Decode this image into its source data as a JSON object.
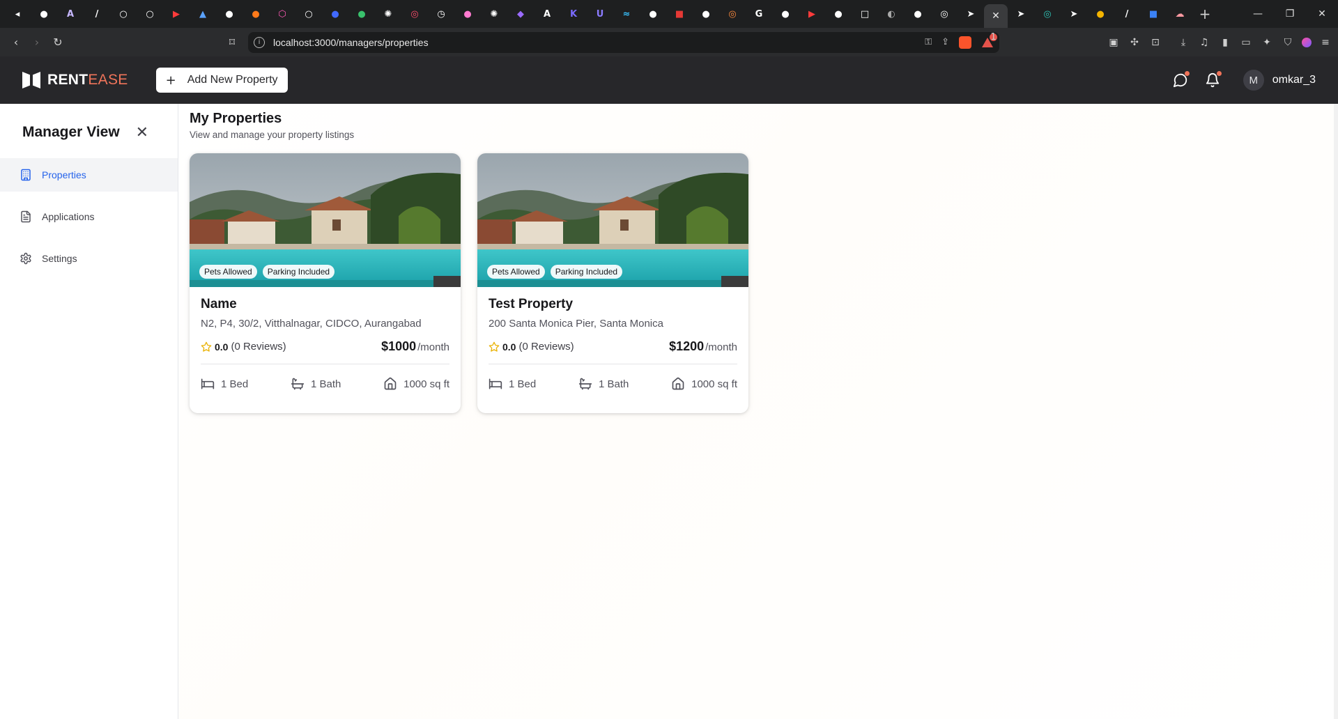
{
  "browser": {
    "tab_favicons": [
      {
        "name": "speaker-icon",
        "glyph": "◂",
        "color": "#ffffff"
      },
      {
        "name": "github-icon",
        "glyph": "●",
        "color": "#ffffff"
      },
      {
        "name": "arc-icon",
        "glyph": "A",
        "color": "#c7b8ff"
      },
      {
        "name": "pen-icon",
        "glyph": "/",
        "color": "#ffffff"
      },
      {
        "name": "circle-icon",
        "glyph": "○",
        "color": "#ffffff"
      },
      {
        "name": "circle-icon",
        "glyph": "○",
        "color": "#ffffff"
      },
      {
        "name": "youtube-icon",
        "glyph": "▶",
        "color": "#ff3b3b"
      },
      {
        "name": "triangle-icon",
        "glyph": "▲",
        "color": "#5aa2ff"
      },
      {
        "name": "github-icon",
        "glyph": "●",
        "color": "#ffffff"
      },
      {
        "name": "orange-icon",
        "glyph": "●",
        "color": "#ff7a1a"
      },
      {
        "name": "hexagon-icon",
        "glyph": "⬡",
        "color": "#ff5ab5"
      },
      {
        "name": "circle-icon",
        "glyph": "○",
        "color": "#ffffff"
      },
      {
        "name": "blue-circle-icon",
        "glyph": "●",
        "color": "#4169ff"
      },
      {
        "name": "green-circle-icon",
        "glyph": "●",
        "color": "#39c16c"
      },
      {
        "name": "openai-icon",
        "glyph": "✺",
        "color": "#ffffff"
      },
      {
        "name": "dot-icon",
        "glyph": "◎",
        "color": "#ff4d6d"
      },
      {
        "name": "clock-icon",
        "glyph": "◷",
        "color": "#ffffff"
      },
      {
        "name": "gradient-icon",
        "glyph": "●",
        "color": "#ff7ad0"
      },
      {
        "name": "openai-icon",
        "glyph": "✺",
        "color": "#ffffff"
      },
      {
        "name": "purple-icon",
        "glyph": "◆",
        "color": "#9b6bff"
      },
      {
        "name": "a-icon",
        "glyph": "A",
        "color": "#ffffff"
      },
      {
        "name": "k-icon",
        "glyph": "K",
        "color": "#7a6bff"
      },
      {
        "name": "ui-icon",
        "glyph": "U",
        "color": "#8b7bff"
      },
      {
        "name": "tailwind-icon",
        "glyph": "≈",
        "color": "#38bdf8"
      },
      {
        "name": "circle-icon",
        "glyph": "●",
        "color": "#ffffff"
      },
      {
        "name": "red-square-icon",
        "glyph": "■",
        "color": "#e53935"
      },
      {
        "name": "circle-icon",
        "glyph": "●",
        "color": "#ffffff"
      },
      {
        "name": "orange-circle-icon",
        "glyph": "◎",
        "color": "#ff8a3d"
      },
      {
        "name": "google-icon",
        "glyph": "G",
        "color": "#ffffff"
      },
      {
        "name": "github-icon",
        "glyph": "●",
        "color": "#ffffff"
      },
      {
        "name": "youtube-icon",
        "glyph": "▶",
        "color": "#ff3b3b"
      },
      {
        "name": "github-icon",
        "glyph": "●",
        "color": "#ffffff"
      },
      {
        "name": "square-icon",
        "glyph": "□",
        "color": "#ffffff"
      },
      {
        "name": "dark-circle-icon",
        "glyph": "◐",
        "color": "#aaaaaa"
      },
      {
        "name": "github-icon",
        "glyph": "●",
        "color": "#ffffff"
      },
      {
        "name": "chrome-icon",
        "glyph": "◎",
        "color": "#ffffff"
      },
      {
        "name": "cursor-icon",
        "glyph": "➤",
        "color": "#ffffff"
      }
    ],
    "active_tab_glyph": "✕",
    "tab_favicons_after": [
      {
        "name": "cursor-icon",
        "glyph": "➤",
        "color": "#ffffff"
      },
      {
        "name": "teal-icon",
        "glyph": "◎",
        "color": "#2ec4b6"
      },
      {
        "name": "cursor-icon",
        "glyph": "➤",
        "color": "#ffffff"
      },
      {
        "name": "google-color-icon",
        "glyph": "●",
        "color": "#f4b400"
      },
      {
        "name": "pen-icon",
        "glyph": "/",
        "color": "#ffffff"
      },
      {
        "name": "blue-square-icon",
        "glyph": "■",
        "color": "#3b82f6"
      },
      {
        "name": "cloud-icon",
        "glyph": "☁",
        "color": "#ff9aa2"
      }
    ],
    "new_tab": "+",
    "url": "localhost:3000/managers/properties",
    "tracker_badge": "1"
  },
  "app": {
    "brand_primary": "RENT",
    "brand_accent": "EASE",
    "add_property_label": "Add New Property",
    "username": "omkar_3",
    "avatar_initial": "M"
  },
  "sidebar": {
    "title": "Manager View",
    "items": [
      {
        "label": "Properties",
        "icon": "building-icon",
        "active": true
      },
      {
        "label": "Applications",
        "icon": "file-text-icon",
        "active": false
      },
      {
        "label": "Settings",
        "icon": "settings-icon",
        "active": false
      }
    ]
  },
  "page": {
    "title": "My Properties",
    "subtitle": "View and manage your property listings"
  },
  "properties": [
    {
      "name": "Name",
      "address": "N2, P4, 30/2, Vitthalnagar, CIDCO, Aurangabad",
      "tags": [
        "Pets Allowed",
        "Parking Included"
      ],
      "rating": "0.0",
      "reviews": "(0 Reviews)",
      "price": "$1000",
      "per": "/month",
      "beds": "1 Bed",
      "baths": "1 Bath",
      "area": "1000 sq ft"
    },
    {
      "name": "Test Property",
      "address": "200 Santa Monica Pier, Santa Monica",
      "tags": [
        "Pets Allowed",
        "Parking Included"
      ],
      "rating": "0.0",
      "reviews": "(0 Reviews)",
      "price": "$1200",
      "per": "/month",
      "beds": "1 Bed",
      "baths": "1 Bath",
      "area": "1000 sq ft"
    }
  ],
  "colors": {
    "navbar_bg": "#27272a",
    "brand_accent": "#f0745a",
    "active_link": "#2563eb",
    "star": "#eab308"
  }
}
